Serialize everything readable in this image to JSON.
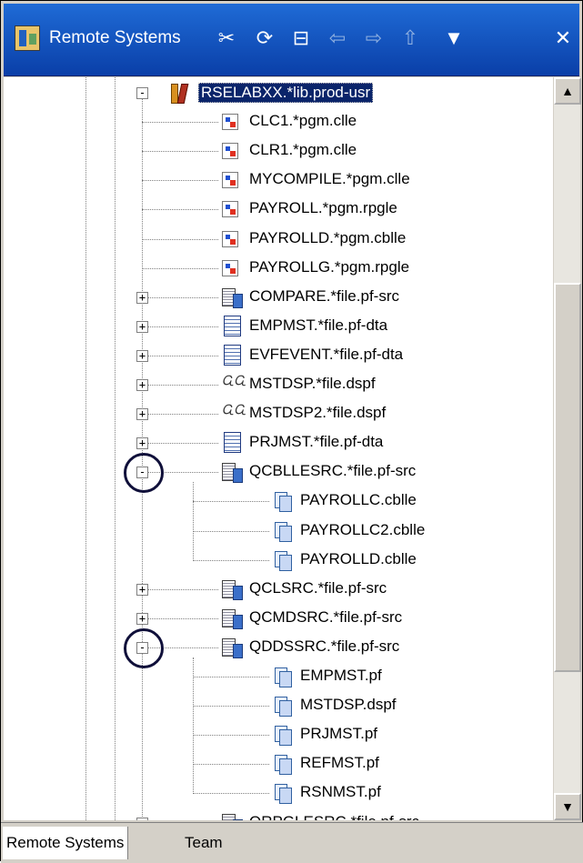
{
  "view": {
    "title": "Remote Systems",
    "toolbar": [
      {
        "name": "remove-filter-icon",
        "glyph": "✂",
        "disabled": false
      },
      {
        "name": "refresh-icon",
        "glyph": "⟳",
        "disabled": false
      },
      {
        "name": "collapse-all-icon",
        "glyph": "⊟",
        "disabled": false
      },
      {
        "name": "back-icon",
        "glyph": "⇦",
        "disabled": true
      },
      {
        "name": "forward-icon",
        "glyph": "⇨",
        "disabled": true
      },
      {
        "name": "up-icon",
        "glyph": "⇧",
        "disabled": true
      },
      {
        "name": "view-menu-icon",
        "glyph": "▼",
        "disabled": false
      },
      {
        "name": "close-icon",
        "glyph": "✕",
        "disabled": false
      }
    ]
  },
  "tree": [
    {
      "label": "RSELABXX.*lib.prod-usr",
      "icon": "lib",
      "level": 0,
      "expander": "-",
      "selected": true
    },
    {
      "label": "CLC1.*pgm.clle",
      "icon": "pgm",
      "level": 1
    },
    {
      "label": "CLR1.*pgm.clle",
      "icon": "pgm",
      "level": 1
    },
    {
      "label": "MYCOMPILE.*pgm.clle",
      "icon": "pgm",
      "level": 1
    },
    {
      "label": "PAYROLL.*pgm.rpgle",
      "icon": "pgm",
      "level": 1
    },
    {
      "label": "PAYROLLD.*pgm.cblle",
      "icon": "pgm",
      "level": 1
    },
    {
      "label": "PAYROLLG.*pgm.rpgle",
      "icon": "pgm",
      "level": 1
    },
    {
      "label": "COMPARE.*file.pf-src",
      "icon": "file-src",
      "level": 1,
      "expander": "+"
    },
    {
      "label": "EMPMST.*file.pf-dta",
      "icon": "file-dta",
      "level": 1,
      "expander": "+"
    },
    {
      "label": "EVFEVENT.*file.pf-dta",
      "icon": "file-dta",
      "level": 1,
      "expander": "+"
    },
    {
      "label": "MSTDSP.*file.dspf",
      "icon": "dspf",
      "level": 1,
      "expander": "+"
    },
    {
      "label": "MSTDSP2.*file.dspf",
      "icon": "dspf",
      "level": 1,
      "expander": "+"
    },
    {
      "label": "PRJMST.*file.pf-dta",
      "icon": "file-dta",
      "level": 1,
      "expander": "+"
    },
    {
      "label": "QCBLLESRC.*file.pf-src",
      "icon": "file-src",
      "level": 1,
      "expander": "-",
      "circled": true
    },
    {
      "label": "PAYROLLC.cblle",
      "icon": "mbr",
      "level": 2
    },
    {
      "label": "PAYROLLC2.cblle",
      "icon": "mbr",
      "level": 2
    },
    {
      "label": "PAYROLLD.cblle",
      "icon": "mbr",
      "level": 2
    },
    {
      "label": "QCLSRC.*file.pf-src",
      "icon": "file-src",
      "level": 1,
      "expander": "+"
    },
    {
      "label": "QCMDSRC.*file.pf-src",
      "icon": "file-src",
      "level": 1,
      "expander": "+"
    },
    {
      "label": "QDDSSRC.*file.pf-src",
      "icon": "file-src",
      "level": 1,
      "expander": "-",
      "circled": true
    },
    {
      "label": "EMPMST.pf",
      "icon": "mbr",
      "level": 2
    },
    {
      "label": "MSTDSP.dspf",
      "icon": "mbr",
      "level": 2
    },
    {
      "label": "PRJMST.pf",
      "icon": "mbr",
      "level": 2
    },
    {
      "label": "REFMST.pf",
      "icon": "mbr",
      "level": 2
    },
    {
      "label": "RSNMST.pf",
      "icon": "mbr",
      "level": 2
    },
    {
      "label": "QRPGLESRC.*file.pf-src",
      "icon": "file-src",
      "level": 1,
      "expander": "+"
    }
  ],
  "scrollbar": {
    "up_glyph": "▲",
    "down_glyph": "▼"
  },
  "tabs": [
    {
      "label": "Remote Systems",
      "active": true
    },
    {
      "label": "Team",
      "active": false
    }
  ]
}
